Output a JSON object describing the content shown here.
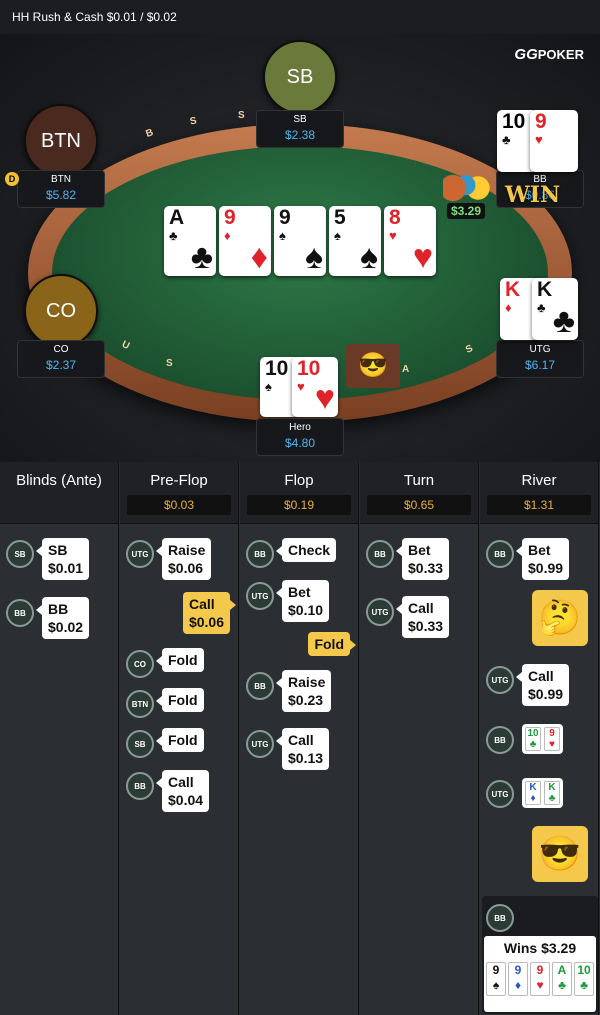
{
  "topbar": {
    "title": "HH  Rush & Cash $0.01 / $0.02"
  },
  "brand": {
    "gg": "GG",
    "name": "POKER"
  },
  "rail_letters": [
    "B",
    "S",
    "S",
    "U",
    "S",
    "A",
    "S"
  ],
  "seats": {
    "sb": {
      "circle": "SB",
      "name": "SB",
      "stack": "$2.38",
      "color": "#6a7a3a"
    },
    "btn": {
      "circle": "BTN",
      "name": "BTN",
      "stack": "$5.82",
      "color": "#4a2a1e"
    },
    "bb": {
      "name": "BB",
      "stack": "$0.86"
    },
    "co": {
      "circle": "CO",
      "name": "CO",
      "stack": "$2.37",
      "color": "#8a6418"
    },
    "utg": {
      "name": "UTG",
      "stack": "$6.17"
    },
    "hero": {
      "name": "Hero",
      "stack": "$4.80"
    }
  },
  "dealer_button": "D",
  "pot": "$3.29",
  "win_label": "WIN",
  "board": [
    {
      "rank": "A",
      "suit": "♣",
      "color": "blk"
    },
    {
      "rank": "9",
      "suit": "♦",
      "color": "red"
    },
    {
      "rank": "9",
      "suit": "♠",
      "color": "blk"
    },
    {
      "rank": "5",
      "suit": "♠",
      "color": "blk"
    },
    {
      "rank": "8",
      "suit": "♥",
      "color": "red"
    }
  ],
  "bb_cards": [
    {
      "rank": "10",
      "suit": "♣",
      "color": "blk"
    },
    {
      "rank": "9",
      "suit": "♥",
      "color": "red"
    }
  ],
  "utg_cards": [
    {
      "rank": "K",
      "suit": "♦",
      "color": "red"
    },
    {
      "rank": "K",
      "suit": "♣",
      "color": "blk"
    }
  ],
  "hero_cards": [
    {
      "rank": "10",
      "suit": "♠",
      "color": "blk"
    },
    {
      "rank": "10",
      "suit": "♥",
      "color": "red"
    }
  ],
  "streets": [
    {
      "name": "Blinds (Ante)",
      "amount": ""
    },
    {
      "name": "Pre-Flop",
      "amount": "$0.03"
    },
    {
      "name": "Flop",
      "amount": "$0.19"
    },
    {
      "name": "Turn",
      "amount": "$0.65"
    },
    {
      "name": "River",
      "amount": "$1.31"
    }
  ],
  "actions": {
    "blinds": [
      {
        "pos": "SB",
        "action": "SB",
        "amount": "$0.01"
      },
      {
        "pos": "BB",
        "action": "BB",
        "amount": "$0.02"
      }
    ],
    "preflop": [
      {
        "pos": "UTG",
        "action": "Raise",
        "amount": "$0.06"
      },
      {
        "hero": true,
        "action": "Call",
        "amount": "$0.06"
      },
      {
        "pos": "CO",
        "action": "Fold"
      },
      {
        "pos": "BTN",
        "action": "Fold"
      },
      {
        "pos": "SB",
        "action": "Fold"
      },
      {
        "pos": "BB",
        "action": "Call",
        "amount": "$0.04"
      }
    ],
    "flop": [
      {
        "pos": "BB",
        "action": "Check"
      },
      {
        "pos": "UTG",
        "action": "Bet",
        "amount": "$0.10"
      },
      {
        "hero": true,
        "action": "Fold"
      },
      {
        "pos": "BB",
        "action": "Raise",
        "amount": "$0.23"
      },
      {
        "pos": "UTG",
        "action": "Call",
        "amount": "$0.13"
      }
    ],
    "turn": [
      {
        "pos": "BB",
        "action": "Bet",
        "amount": "$0.33"
      },
      {
        "pos": "UTG",
        "action": "Call",
        "amount": "$0.33"
      }
    ],
    "river": [
      {
        "pos": "BB",
        "action": "Bet",
        "amount": "$0.99"
      },
      {
        "emoji": "🤔"
      },
      {
        "pos": "UTG",
        "action": "Call",
        "amount": "$0.99"
      },
      {
        "pos": "BB",
        "show": [
          {
            "r": "10",
            "s": "♣",
            "c": "grn"
          },
          {
            "r": "9",
            "s": "♥",
            "c": "red"
          }
        ]
      },
      {
        "pos": "UTG",
        "show": [
          {
            "r": "K",
            "s": "♦",
            "c": "blu"
          },
          {
            "r": "K",
            "s": "♣",
            "c": "grn"
          }
        ]
      },
      {
        "emoji": "😎"
      }
    ]
  },
  "winner": {
    "pos": "BB",
    "text": "Wins $3.29",
    "cards": [
      {
        "r": "9",
        "s": "♠",
        "c": "blk"
      },
      {
        "r": "9",
        "s": "♦",
        "c": "blu"
      },
      {
        "r": "9",
        "s": "♥",
        "c": "red"
      },
      {
        "r": "A",
        "s": "♣",
        "c": "grn"
      },
      {
        "r": "10",
        "s": "♣",
        "c": "grn"
      }
    ]
  }
}
